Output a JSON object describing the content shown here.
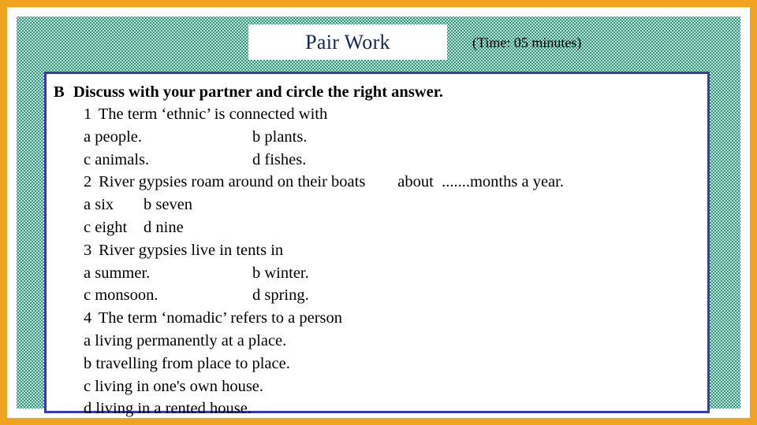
{
  "slide": {
    "frame_color": "#f0a31e",
    "field_color": "#2a9478",
    "panel_border_color": "#3a3ab0",
    "title_color": "#13265c"
  },
  "header": {
    "title": "Pair Work",
    "time_note": "(Time: 05 minutes)"
  },
  "content": {
    "instruction_letter": "B",
    "instruction_text": "Discuss with your partner and circle the right answer.",
    "questions": [
      {
        "number": "1",
        "stem": "The term ‘ethnic’ is connected with",
        "layout": "two-column-wide",
        "rows": [
          [
            "a people.",
            "b plants."
          ],
          [
            "c animals.",
            "d fishes."
          ]
        ]
      },
      {
        "number": "2",
        "stem": "River gypsies roam around on their boats        about  .......months a year.",
        "layout": "two-column-narrow",
        "rows": [
          [
            "a six",
            "b seven"
          ],
          [
            "c eight",
            "d nine"
          ]
        ]
      },
      {
        "number": "3",
        "stem": "River gypsies live in tents in",
        "layout": "two-column-wide",
        "rows": [
          [
            "a summer.",
            "b winter."
          ],
          [
            "c monsoon.",
            "d spring."
          ]
        ]
      },
      {
        "number": "4",
        "stem": "The term ‘nomadic’ refers to a person",
        "layout": "stacked",
        "rows": [
          [
            "a living permanently at a place."
          ],
          [
            "b travelling from place to place."
          ],
          [
            "c living in one's own house."
          ],
          [
            "d living in a rented house."
          ]
        ]
      }
    ]
  }
}
